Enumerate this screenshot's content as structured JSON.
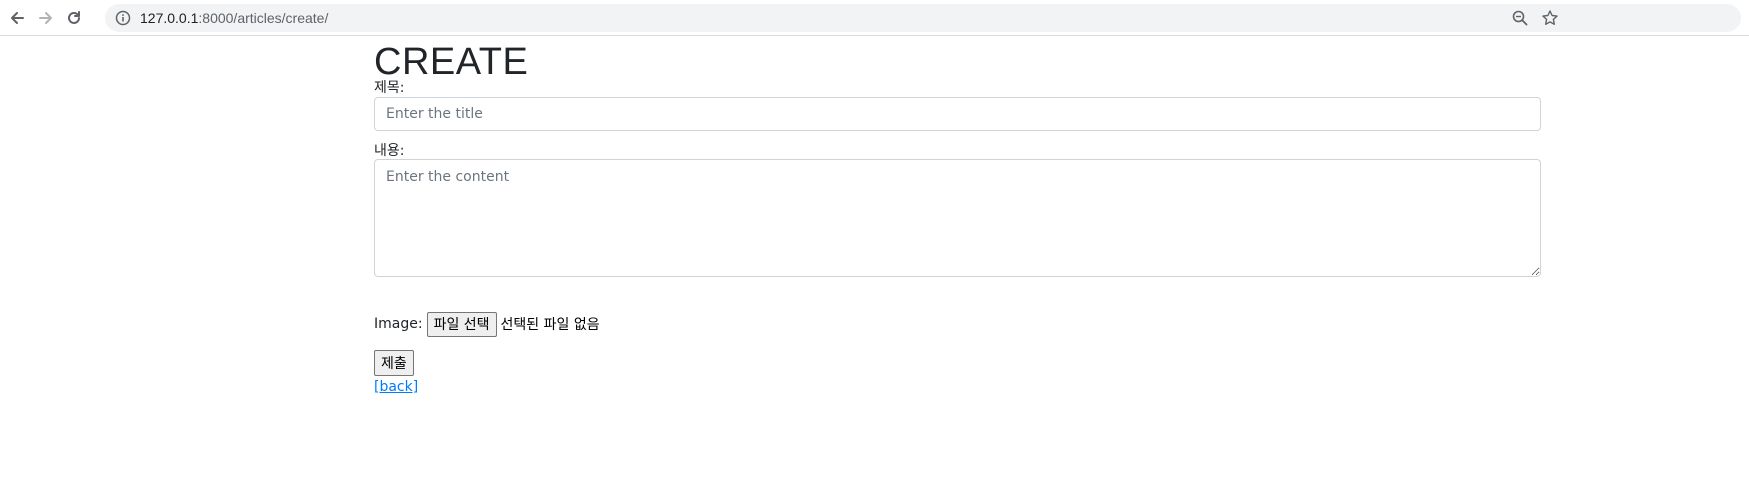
{
  "browser": {
    "url_host": "127.0.0.1",
    "url_rest": ":8000/articles/create/",
    "icons": {
      "back": "back-arrow-icon",
      "forward": "forward-arrow-icon",
      "reload": "reload-icon",
      "info": "info-icon",
      "zoom": "zoom-icon",
      "bookmark": "star-icon"
    }
  },
  "page": {
    "title": "CREATE",
    "form": {
      "title_label": "제목:",
      "title_placeholder": "Enter the title",
      "title_value": "",
      "content_label": "내용:",
      "content_placeholder": "Enter the content",
      "content_value": "",
      "image_label": "Image:",
      "file_button_label": "파일 선택",
      "file_status": "선택된 파일 없음",
      "submit_label": "제출"
    },
    "back_link": "[back]"
  },
  "colors": {
    "link": "#007bff",
    "input_border": "#ced4da",
    "placeholder": "#6c757d",
    "omnibox_bg": "#f1f3f4"
  }
}
